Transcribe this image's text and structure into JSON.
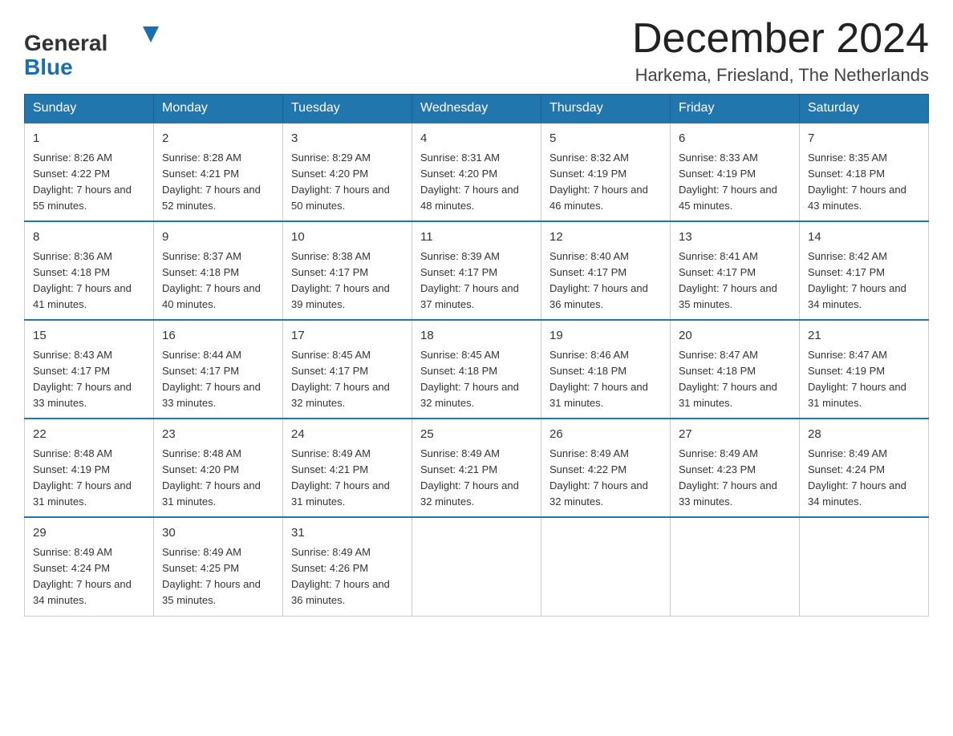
{
  "header": {
    "logo_general": "General",
    "logo_blue": "Blue",
    "month_title": "December 2024",
    "location": "Harkema, Friesland, The Netherlands"
  },
  "weekdays": [
    "Sunday",
    "Monday",
    "Tuesday",
    "Wednesday",
    "Thursday",
    "Friday",
    "Saturday"
  ],
  "weeks": [
    [
      {
        "day": "1",
        "sunrise": "8:26 AM",
        "sunset": "4:22 PM",
        "daylight": "7 hours and 55 minutes."
      },
      {
        "day": "2",
        "sunrise": "8:28 AM",
        "sunset": "4:21 PM",
        "daylight": "7 hours and 52 minutes."
      },
      {
        "day": "3",
        "sunrise": "8:29 AM",
        "sunset": "4:20 PM",
        "daylight": "7 hours and 50 minutes."
      },
      {
        "day": "4",
        "sunrise": "8:31 AM",
        "sunset": "4:20 PM",
        "daylight": "7 hours and 48 minutes."
      },
      {
        "day": "5",
        "sunrise": "8:32 AM",
        "sunset": "4:19 PM",
        "daylight": "7 hours and 46 minutes."
      },
      {
        "day": "6",
        "sunrise": "8:33 AM",
        "sunset": "4:19 PM",
        "daylight": "7 hours and 45 minutes."
      },
      {
        "day": "7",
        "sunrise": "8:35 AM",
        "sunset": "4:18 PM",
        "daylight": "7 hours and 43 minutes."
      }
    ],
    [
      {
        "day": "8",
        "sunrise": "8:36 AM",
        "sunset": "4:18 PM",
        "daylight": "7 hours and 41 minutes."
      },
      {
        "day": "9",
        "sunrise": "8:37 AM",
        "sunset": "4:18 PM",
        "daylight": "7 hours and 40 minutes."
      },
      {
        "day": "10",
        "sunrise": "8:38 AM",
        "sunset": "4:17 PM",
        "daylight": "7 hours and 39 minutes."
      },
      {
        "day": "11",
        "sunrise": "8:39 AM",
        "sunset": "4:17 PM",
        "daylight": "7 hours and 37 minutes."
      },
      {
        "day": "12",
        "sunrise": "8:40 AM",
        "sunset": "4:17 PM",
        "daylight": "7 hours and 36 minutes."
      },
      {
        "day": "13",
        "sunrise": "8:41 AM",
        "sunset": "4:17 PM",
        "daylight": "7 hours and 35 minutes."
      },
      {
        "day": "14",
        "sunrise": "8:42 AM",
        "sunset": "4:17 PM",
        "daylight": "7 hours and 34 minutes."
      }
    ],
    [
      {
        "day": "15",
        "sunrise": "8:43 AM",
        "sunset": "4:17 PM",
        "daylight": "7 hours and 33 minutes."
      },
      {
        "day": "16",
        "sunrise": "8:44 AM",
        "sunset": "4:17 PM",
        "daylight": "7 hours and 33 minutes."
      },
      {
        "day": "17",
        "sunrise": "8:45 AM",
        "sunset": "4:17 PM",
        "daylight": "7 hours and 32 minutes."
      },
      {
        "day": "18",
        "sunrise": "8:45 AM",
        "sunset": "4:18 PM",
        "daylight": "7 hours and 32 minutes."
      },
      {
        "day": "19",
        "sunrise": "8:46 AM",
        "sunset": "4:18 PM",
        "daylight": "7 hours and 31 minutes."
      },
      {
        "day": "20",
        "sunrise": "8:47 AM",
        "sunset": "4:18 PM",
        "daylight": "7 hours and 31 minutes."
      },
      {
        "day": "21",
        "sunrise": "8:47 AM",
        "sunset": "4:19 PM",
        "daylight": "7 hours and 31 minutes."
      }
    ],
    [
      {
        "day": "22",
        "sunrise": "8:48 AM",
        "sunset": "4:19 PM",
        "daylight": "7 hours and 31 minutes."
      },
      {
        "day": "23",
        "sunrise": "8:48 AM",
        "sunset": "4:20 PM",
        "daylight": "7 hours and 31 minutes."
      },
      {
        "day": "24",
        "sunrise": "8:49 AM",
        "sunset": "4:21 PM",
        "daylight": "7 hours and 31 minutes."
      },
      {
        "day": "25",
        "sunrise": "8:49 AM",
        "sunset": "4:21 PM",
        "daylight": "7 hours and 32 minutes."
      },
      {
        "day": "26",
        "sunrise": "8:49 AM",
        "sunset": "4:22 PM",
        "daylight": "7 hours and 32 minutes."
      },
      {
        "day": "27",
        "sunrise": "8:49 AM",
        "sunset": "4:23 PM",
        "daylight": "7 hours and 33 minutes."
      },
      {
        "day": "28",
        "sunrise": "8:49 AM",
        "sunset": "4:24 PM",
        "daylight": "7 hours and 34 minutes."
      }
    ],
    [
      {
        "day": "29",
        "sunrise": "8:49 AM",
        "sunset": "4:24 PM",
        "daylight": "7 hours and 34 minutes."
      },
      {
        "day": "30",
        "sunrise": "8:49 AM",
        "sunset": "4:25 PM",
        "daylight": "7 hours and 35 minutes."
      },
      {
        "day": "31",
        "sunrise": "8:49 AM",
        "sunset": "4:26 PM",
        "daylight": "7 hours and 36 minutes."
      },
      null,
      null,
      null,
      null
    ]
  ]
}
